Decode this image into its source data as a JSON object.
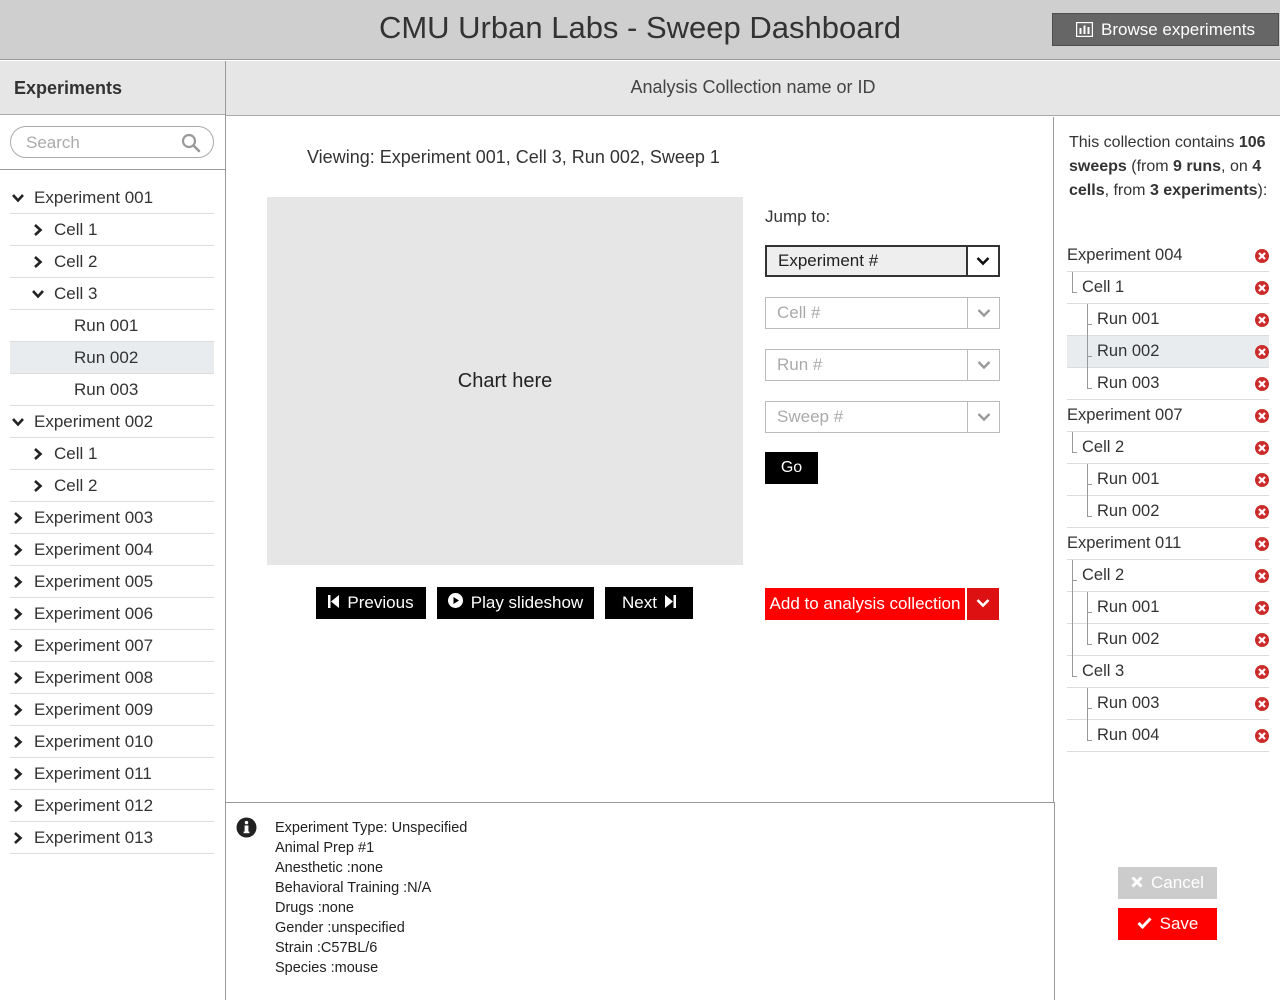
{
  "header": {
    "title": "CMU Urban Labs - Sweep Dashboard",
    "browse_label": "Browse experiments"
  },
  "sidebar": {
    "heading": "Experiments",
    "search_placeholder": "Search",
    "tree": [
      {
        "label": "Experiment 001",
        "level": 0,
        "expanded": true,
        "selected": false
      },
      {
        "label": "Cell 1",
        "level": 1,
        "expanded": false,
        "selected": false
      },
      {
        "label": "Cell 2",
        "level": 1,
        "expanded": false,
        "selected": false
      },
      {
        "label": "Cell 3",
        "level": 1,
        "expanded": true,
        "selected": false
      },
      {
        "label": "Run 001",
        "level": 2,
        "selected": false
      },
      {
        "label": "Run 002",
        "level": 2,
        "selected": true
      },
      {
        "label": "Run 003",
        "level": 2,
        "selected": false
      },
      {
        "label": "Experiment 002",
        "level": 0,
        "expanded": true,
        "selected": false
      },
      {
        "label": "Cell 1",
        "level": 1,
        "expanded": false,
        "selected": false
      },
      {
        "label": "Cell 2",
        "level": 1,
        "expanded": false,
        "selected": false
      },
      {
        "label": "Experiment 003",
        "level": 0,
        "expanded": false,
        "selected": false
      },
      {
        "label": "Experiment 004",
        "level": 0,
        "expanded": false,
        "selected": false
      },
      {
        "label": "Experiment 005",
        "level": 0,
        "expanded": false,
        "selected": false
      },
      {
        "label": "Experiment 006",
        "level": 0,
        "expanded": false,
        "selected": false
      },
      {
        "label": "Experiment 007",
        "level": 0,
        "expanded": false,
        "selected": false
      },
      {
        "label": "Experiment 008",
        "level": 0,
        "expanded": false,
        "selected": false
      },
      {
        "label": "Experiment 009",
        "level": 0,
        "expanded": false,
        "selected": false
      },
      {
        "label": "Experiment 010",
        "level": 0,
        "expanded": false,
        "selected": false
      },
      {
        "label": "Experiment 011",
        "level": 0,
        "expanded": false,
        "selected": false
      },
      {
        "label": "Experiment 012",
        "level": 0,
        "expanded": false,
        "selected": false
      },
      {
        "label": "Experiment 013",
        "level": 0,
        "expanded": false,
        "selected": false
      }
    ]
  },
  "collection_bar": {
    "placeholder": "Analysis Collection name or ID"
  },
  "main": {
    "viewing": "Viewing: Experiment 001, Cell 3, Run 002, Sweep 1",
    "chart_placeholder": "Chart here",
    "jump_label": "Jump to:",
    "selects": {
      "experiment": "Experiment #",
      "cell": "Cell #",
      "run": "Run #",
      "sweep": "Sweep #"
    },
    "go_label": "Go",
    "previous_label": "Previous",
    "play_label": "Play slideshow",
    "next_label": "Next",
    "add_label": "Add to analysis collection"
  },
  "info": {
    "lines": [
      "Experiment Type: Unspecified",
      "Animal Prep #1",
      "Anesthetic :none",
      "Behavioral Training :N/A",
      "Drugs :none",
      "Gender :unspecified",
      "Strain :C57BL/6",
      "Species :mouse"
    ]
  },
  "collection": {
    "summary_parts": [
      {
        "text": "This collection contains ",
        "bold": false
      },
      {
        "text": "106 sweeps",
        "bold": true
      },
      {
        "text": " (from ",
        "bold": false
      },
      {
        "text": "9 runs",
        "bold": true
      },
      {
        "text": ", on ",
        "bold": false
      },
      {
        "text": "4 cells",
        "bold": true
      },
      {
        "text": ", from ",
        "bold": false
      },
      {
        "text": "3 experiments",
        "bold": true
      },
      {
        "text": "):",
        "bold": false
      }
    ],
    "tree": [
      {
        "label": "Experiment 004",
        "level": 0,
        "selected": false
      },
      {
        "label": "Cell 1",
        "level": 1,
        "selected": false
      },
      {
        "label": "Run 001",
        "level": 2,
        "selected": false
      },
      {
        "label": "Run 002",
        "level": 2,
        "selected": true
      },
      {
        "label": "Run 003",
        "level": 2,
        "selected": false
      },
      {
        "label": "Experiment 007",
        "level": 0,
        "selected": false
      },
      {
        "label": "Cell 2",
        "level": 1,
        "selected": false
      },
      {
        "label": "Run 001",
        "level": 2,
        "selected": false
      },
      {
        "label": "Run 002",
        "level": 2,
        "selected": false
      },
      {
        "label": "Experiment 011",
        "level": 0,
        "selected": false
      },
      {
        "label": "Cell 2",
        "level": 1,
        "selected": false
      },
      {
        "label": "Run 001",
        "level": 2,
        "selected": false
      },
      {
        "label": "Run 002",
        "level": 2,
        "selected": false
      },
      {
        "label": "Cell 3",
        "level": 1,
        "selected": false
      },
      {
        "label": "Run 003",
        "level": 2,
        "selected": false
      },
      {
        "label": "Run 004",
        "level": 2,
        "selected": false
      }
    ],
    "cancel_label": "Cancel",
    "save_label": "Save"
  },
  "colors": {
    "accent_red": "#ff0000",
    "header_gray": "#cfcfcf",
    "panel_gray": "#e6e6e6",
    "remove_icon_red": "#cc2b2b"
  }
}
